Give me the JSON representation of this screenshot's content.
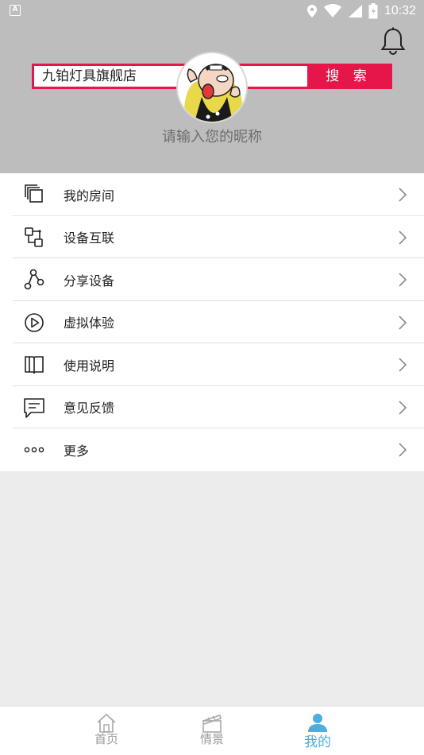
{
  "status_bar": {
    "time": "10:32",
    "icons": [
      "a-notification-icon",
      "location-icon",
      "wifi-icon",
      "signal-icon",
      "battery-icon"
    ]
  },
  "header": {
    "search_field_text": "九铂灯具旗舰店",
    "search_button_label": "搜 索",
    "nickname_prompt": "请输入您的昵称",
    "accent_color": "#e6164a",
    "background_color": "#bdbdbd"
  },
  "menu": {
    "items": [
      {
        "label": "我的房间",
        "icon": "rooms-icon"
      },
      {
        "label": "设备互联",
        "icon": "device-link-icon"
      },
      {
        "label": "分享设备",
        "icon": "share-icon"
      },
      {
        "label": "虚拟体验",
        "icon": "play-icon"
      },
      {
        "label": "使用说明",
        "icon": "manual-icon"
      },
      {
        "label": "意见反馈",
        "icon": "feedback-icon"
      },
      {
        "label": "更多",
        "icon": "more-icon"
      }
    ]
  },
  "tab_bar": {
    "tabs": [
      {
        "label": "首页",
        "icon": "home-icon",
        "active": false
      },
      {
        "label": "情景",
        "icon": "scene-icon",
        "active": false
      },
      {
        "label": "我的",
        "icon": "profile-icon",
        "active": true
      }
    ],
    "active_color": "#4aaee0"
  }
}
